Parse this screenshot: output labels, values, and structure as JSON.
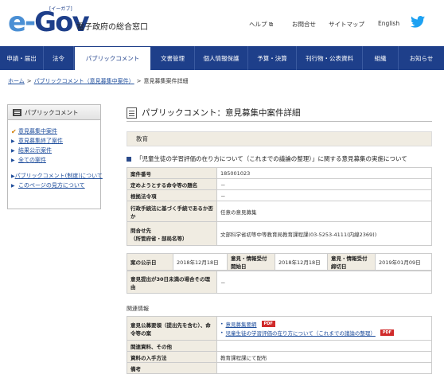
{
  "header": {
    "logo_text_e": "e-",
    "logo_text_gov": "Gov",
    "logo_ruby": "[イーガブ]",
    "subtitle": "電子政府の総合窓口",
    "links": {
      "help": "ヘルプ",
      "contact": "お問合せ",
      "sitemap": "サイトマップ",
      "english": "English"
    }
  },
  "nav": {
    "items": [
      {
        "label": "申請・届出"
      },
      {
        "label": "法令"
      },
      {
        "label": "パブリックコメント"
      },
      {
        "label": "文書管理"
      },
      {
        "label": "個人情報保護"
      },
      {
        "label": "予算・決算"
      },
      {
        "label": "刊行物・公表資料"
      },
      {
        "label": "組織"
      },
      {
        "label": "お知らせ"
      }
    ],
    "active_index": 2
  },
  "breadcrumb": {
    "home": "ホーム",
    "public_comment": "パブリックコメント（意見募集中案件）",
    "current": "意見募集案件詳細",
    "sep": ">"
  },
  "sidebar": {
    "title": "パブリックコメント",
    "items": [
      {
        "label": "意見募集中案件"
      },
      {
        "label": "意見募集終了案件"
      },
      {
        "label": "結果公示案件"
      },
      {
        "label": "全ての案件"
      },
      {
        "label": "パブリックコメント(制度)について"
      },
      {
        "label": "このページの見方について"
      }
    ]
  },
  "main": {
    "title": "パブリックコメント：意見募集中案件詳細",
    "category": "教育",
    "notice_title": "「児童生徒の学習評価の在り方について（これまでの議論の整理）」に関する意見募集の実施について",
    "rows": [
      {
        "label": "案件番号",
        "value": "185001023"
      },
      {
        "label": "定めようとする命令等の題名",
        "value": "－"
      },
      {
        "label": "根拠法令項",
        "value": "－"
      },
      {
        "label": "行政手続法に基づく手続であるか否か",
        "value": "任意の意見募集"
      },
      {
        "label": "問合せ先\n（所管府省・部局名等）",
        "value": "文部科学省初等中等教育局教育課程課(03-5253-4111(内線2369))"
      }
    ],
    "dates": {
      "announce_label": "案の公示日",
      "announce_value": "2018年12月18日",
      "start_label": "意見・情報受付開始日",
      "start_value": "2018年12月18日",
      "end_label": "意見・情報受付締切日",
      "end_value": "2019年01月09日"
    },
    "reason": {
      "label": "意見提出が30日未満の場合その理由",
      "value": "－"
    },
    "related_title": "関連情報",
    "related": {
      "docs_label": "意見公募要領（提出先を含む）、命令等の案",
      "links": [
        {
          "label": "意見募集要綱",
          "badge": "PDF"
        },
        {
          "label": "児童生徒の学習評価の在り方について（これまでの議論の整理）",
          "badge": "PDF"
        }
      ],
      "materials_label": "関連資料、その他",
      "materials_value": "",
      "obtain_label": "資料の入手方法",
      "obtain_value": "教育課程課にて配布",
      "notes_label": "備考",
      "notes_value": ""
    }
  },
  "colors": {
    "brand": "#1e3f8a",
    "label_bg": "#f0ece2",
    "pdf": "#d02a2a",
    "link": "#1f4e9c"
  }
}
